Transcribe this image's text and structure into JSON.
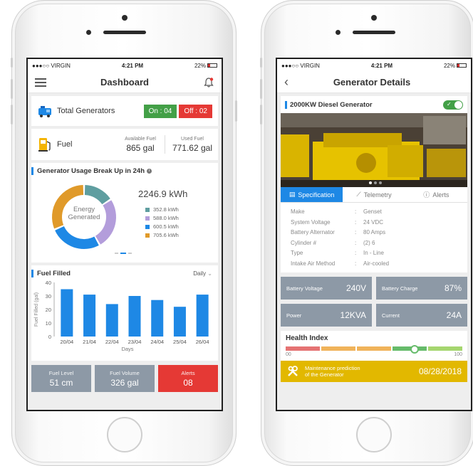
{
  "dashboard": {
    "status": {
      "carrier": "●●●○○ VIRGIN",
      "time": "4:21 PM",
      "battery": "22%"
    },
    "title": "Dashboard",
    "generators": {
      "label": "Total Generators",
      "on_label": "On : 04",
      "off_label": "Off : 02"
    },
    "fuel": {
      "label": "Fuel",
      "available_label": "Available Fuel",
      "available_value": "865 gal",
      "used_label": "Used Fuel",
      "used_value": "771.62 gal"
    },
    "usage": {
      "title": "Generator Usage Break Up in 24h",
      "total": "2246.9 kWh",
      "center_line1": "Energy",
      "center_line2": "Generated",
      "legend": [
        {
          "label": "352.8 kWh",
          "color": "#5f9ea0",
          "value": 352.8
        },
        {
          "label": "588.0 kWh",
          "color": "#b39ddb",
          "value": 588.0
        },
        {
          "label": "600.5 kWh",
          "color": "#1e88e5",
          "value": 600.5
        },
        {
          "label": "705.6 kWh",
          "color": "#e09a2a",
          "value": 705.6
        }
      ]
    },
    "fuel_filled": {
      "title": "Fuel Filled",
      "period": "Daily",
      "chart_data": {
        "type": "bar",
        "categories": [
          "20/04",
          "21/04",
          "22/04",
          "23/04",
          "24/04",
          "25/04",
          "26/04"
        ],
        "values": [
          35,
          31,
          24,
          30,
          27,
          22,
          31
        ],
        "xlabel": "Days",
        "ylabel": "Fuel Filled (gal)",
        "ylim": [
          0,
          40
        ],
        "yticks": [
          "0",
          "10",
          "20",
          "30",
          "40"
        ]
      }
    },
    "tiles": {
      "fuel_level_label": "Fuel Level",
      "fuel_level_value": "51 cm",
      "fuel_volume_label": "Fuel Volume",
      "fuel_volume_value": "326 gal",
      "alerts_label": "Alerts",
      "alerts_value": "08"
    }
  },
  "details": {
    "status": {
      "carrier": "●●●○○ VIRGIN",
      "time": "4:21 PM",
      "battery": "22%"
    },
    "title": "Generator Details",
    "generator_name": "2000KW Diesel Generator",
    "tabs": [
      "Specification",
      "Telemetry",
      "Alerts"
    ],
    "specs": [
      {
        "key": "Make",
        "value": "Genset"
      },
      {
        "key": "System Voltage",
        "value": "24 VDC"
      },
      {
        "key": "Battery Alternator",
        "value": "80 Amps"
      },
      {
        "key": "Cylinder #",
        "value": "(2) 6"
      },
      {
        "key": "Type",
        "value": "In - Line"
      },
      {
        "key": "Intake Air Method",
        "value": "Air-cooled"
      }
    ],
    "metrics": [
      {
        "label": "Battery Voltage",
        "value": "240V"
      },
      {
        "label": "Battery Charge",
        "value": "87%"
      },
      {
        "label": "Power",
        "value": "12KVA"
      },
      {
        "label": "Current",
        "value": "24A"
      }
    ],
    "health": {
      "title": "Health Index",
      "min": "00",
      "max": "100",
      "value": 72
    },
    "maintenance": {
      "line1": "Maintenance prediction",
      "line2": "of the Generator",
      "date": "08/28/2018"
    }
  }
}
